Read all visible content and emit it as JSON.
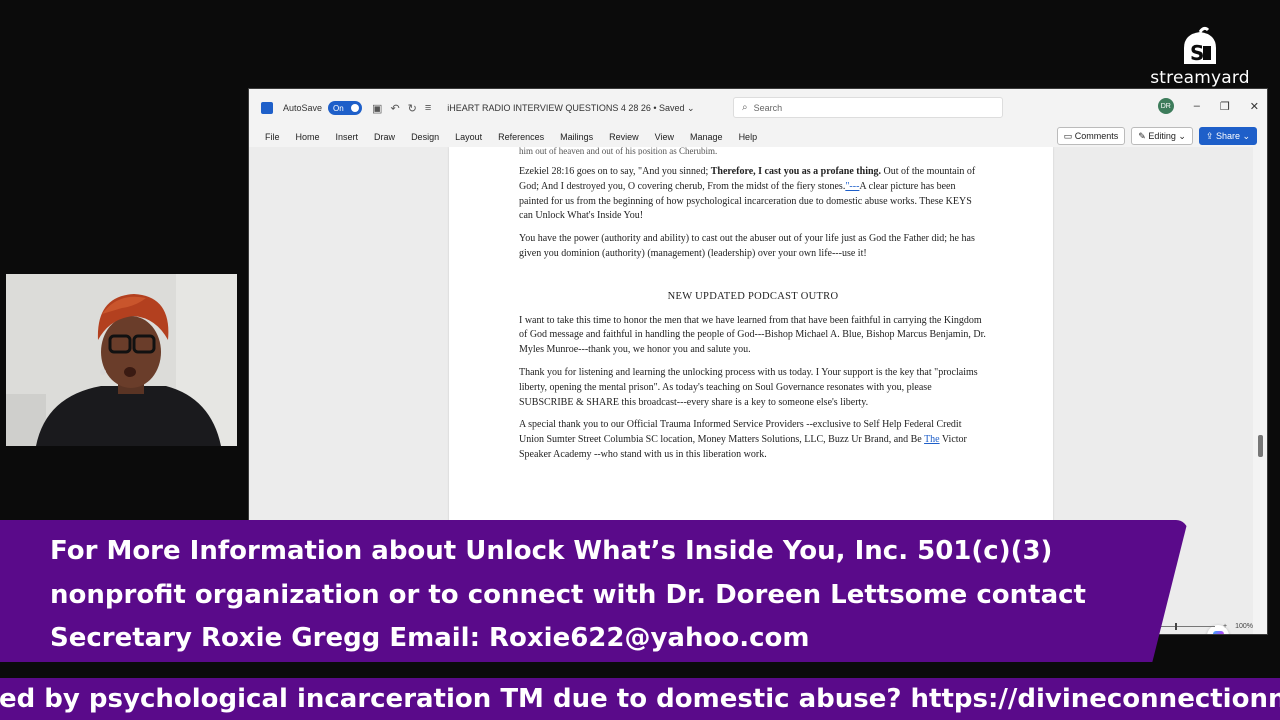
{
  "logo": {
    "word": "streamyard"
  },
  "word": {
    "autosave_label": "AutoSave",
    "autosave_state": "On",
    "doc_title": "iHEART RADIO INTERVIEW QUESTIONS 4 28 26 • Saved ⌄",
    "search_placeholder": "Search",
    "user_initials": "DR",
    "menu": [
      "File",
      "Home",
      "Insert",
      "Draw",
      "Design",
      "Layout",
      "References",
      "Mailings",
      "Review",
      "View",
      "Manage",
      "Help"
    ],
    "comments_label": "Comments",
    "editing_label": "Editing ⌄",
    "share_label": "Share ⌄",
    "zoom_label": "100%",
    "cut_line": "him out of heaven and out of his position as Cherubim.",
    "p1_start": "Ezekiel 28:16 goes on to say, \"And you sinned; ",
    "p1_bold": "Therefore, I cast you as a profane thing.",
    "p1_mid": " Out of the mountain of God; And I destroyed you, O covering cherub, From the midst of the fiery stones.",
    "p1_link": "\"---",
    "p1_end": "A clear picture has been painted for us from the beginning of how psychological incarceration due to domestic abuse works. These KEYS can Unlock What's Inside You!",
    "p2": "You have the power (authority and ability) to cast out the abuser out of your life just as God the Father did; he has given you dominion (authority) (management) (leadership) over your own life---use it!",
    "heading": "NEW UPDATED PODCAST OUTRO",
    "p3": "I want to take this time to honor the men that we have learned from that have been faithful in carrying the Kingdom of God message and faithful in handling the people of God---Bishop Michael A. Blue, Bishop Marcus Benjamin, Dr. Myles Munroe---thank you, we honor you and salute you.",
    "p4": "Thank you for listening and learning the unlocking process with us today. I Your support is the key that \"proclaims liberty, opening the mental prison\". As today's teaching on Soul Governance resonates with you, please SUBSCRIBE & SHARE this broadcast---every share is a key to someone else's liberty.",
    "p5_start": "A special thank you to our Official Trauma Informed Service Providers --exclusive to Self Help Federal Credit Union Sumter Street Columbia SC location, Money Matters Solutions, LLC, Buzz Ur Brand, and Be ",
    "p5_the": "The",
    "p5_end": " Victor Speaker Academy --who stand with us in this liberation work."
  },
  "banner": {
    "line1": "For More Information about Unlock What’s Inside You, Inc. 501(c)(3)",
    "line2": "nonprofit organization or to connect with Dr. Doreen Lettsome contact",
    "line3": "Secretary Roxie Gregg Email: Roxie622@yahoo.com"
  },
  "ticker": {
    "text": "ed by psychological incarceration TM due to domestic abuse? https://divineconnectionnetworkasso"
  },
  "colors": {
    "banner": "#5a0a8a",
    "word_blue": "#1e5fc9"
  }
}
